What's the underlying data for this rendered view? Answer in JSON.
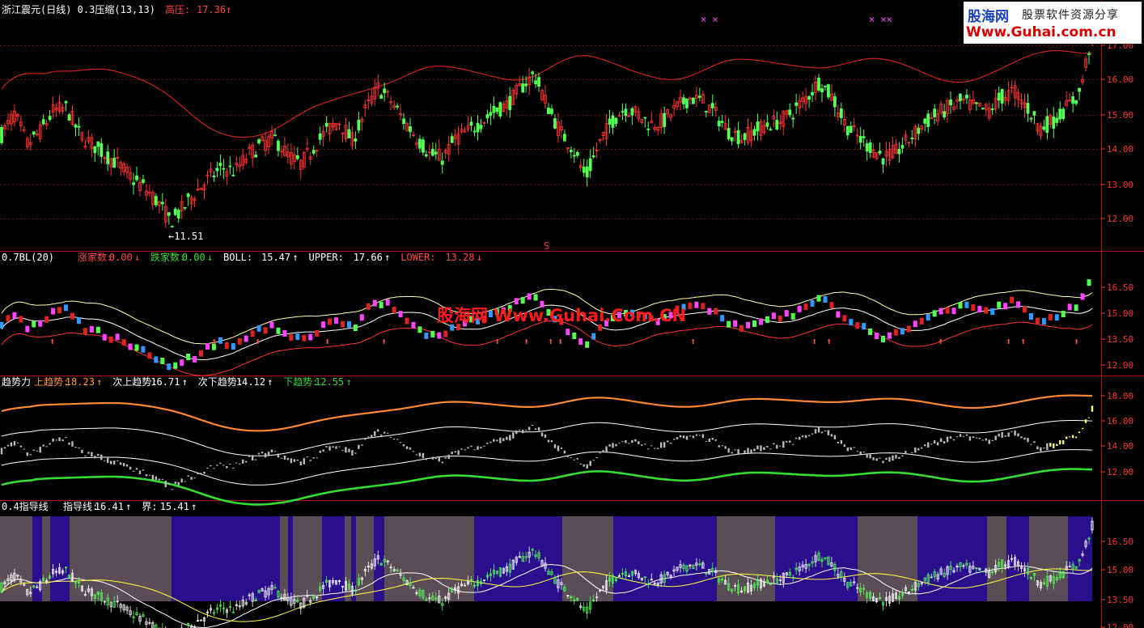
{
  "panel1": {
    "title": "浙江震元(日线) 0.3压缩(13,13)",
    "indicator_label": "高压:",
    "indicator_value": "17.36",
    "low_marker": "←11.51",
    "marker_s": "S",
    "x_marks": [
      "× ×",
      "× ××"
    ]
  },
  "panel2": {
    "title": "0.7BL(20)",
    "items": [
      {
        "label": "涨家数:",
        "value": "0.00",
        "arrow": "↓",
        "color": "#ff4444"
      },
      {
        "label": "跌家数:",
        "value": "0.00",
        "arrow": "↓",
        "color": "#33dd33"
      },
      {
        "label": "BOLL:",
        "value": "15.47",
        "arrow": "↑",
        "color": "#ffffff"
      },
      {
        "label": "UPPER:",
        "value": "17.66",
        "arrow": "↑",
        "color": "#ffffff"
      },
      {
        "label": "LOWER:",
        "value": "13.28",
        "arrow": "↓",
        "color": "#ff4444"
      }
    ]
  },
  "panel3": {
    "title": "趋势力",
    "items": [
      {
        "label": "上趋势:",
        "value": "18.23",
        "arrow": "↑",
        "color": "#ff9933"
      },
      {
        "label": "次上趋势:",
        "value": "16.71",
        "arrow": "↑",
        "color": "#ffffff"
      },
      {
        "label": "次下趋势:",
        "value": "14.12",
        "arrow": "↑",
        "color": "#ffffff"
      },
      {
        "label": "下趋势:",
        "value": "12.55",
        "arrow": "↑",
        "color": "#33dd33"
      }
    ]
  },
  "panel4": {
    "title": "0.4指导线",
    "items": [
      {
        "label": "指导线:",
        "value": "16.41",
        "arrow": "↑",
        "color": "#ffffff"
      },
      {
        "label": "界:",
        "value": "15.41",
        "arrow": "↑",
        "color": "#ffffff"
      }
    ]
  },
  "axes": {
    "p1": [
      "17.00",
      "16.00",
      "15.00",
      "14.00",
      "13.00",
      "12.00"
    ],
    "p2": [
      "16.50",
      "15.00",
      "13.50",
      "12.00"
    ],
    "p3": [
      "18.00",
      "16.00",
      "14.00",
      "12.00"
    ],
    "p4": [
      "16.50",
      "15.00",
      "13.50",
      "12.00"
    ]
  },
  "logo": {
    "line1": "股海网",
    "line1b": "股票软件资源分享",
    "line2": "Www.Guhai.com.cn"
  },
  "watermark": "股海网 Www.Guhai.Com.CN",
  "colors": {
    "up": "#ff3333",
    "down": "#54ff54",
    "band": "#cc2222",
    "bg": "#000000",
    "zone_a": "#5a4d55",
    "zone_b": "#2a0f8c"
  },
  "chart_data": {
    "type": "candlestick",
    "price_range": [
      11.51,
      17.36
    ],
    "close_points": [
      14.2,
      14.8,
      13.9,
      14.3,
      14.9,
      15.0,
      14.2,
      13.9,
      13.6,
      13.3,
      12.9,
      12.6,
      12.2,
      11.6,
      12.0,
      12.5,
      12.9,
      13.2,
      13.1,
      13.6,
      13.9,
      14.1,
      13.6,
      13.3,
      13.8,
      14.3,
      14.6,
      14.0,
      14.9,
      15.6,
      15.2,
      14.6,
      14.1,
      13.6,
      13.5,
      14.1,
      14.3,
      14.6,
      14.9,
      15.1,
      15.6,
      16.0,
      15.1,
      14.3,
      13.8,
      12.9,
      13.9,
      14.6,
      15.0,
      14.8,
      14.5,
      14.6,
      15.0,
      15.3,
      15.2,
      14.8,
      14.3,
      14.1,
      14.3,
      14.5,
      14.6,
      14.9,
      15.3,
      15.8,
      15.3,
      14.5,
      14.1,
      13.8,
      13.5,
      13.7,
      14.1,
      14.5,
      14.8,
      15.0,
      15.2,
      15.0,
      14.9,
      15.3,
      15.5,
      15.0,
      14.4,
      14.6,
      15.0,
      15.4,
      17.2
    ]
  }
}
